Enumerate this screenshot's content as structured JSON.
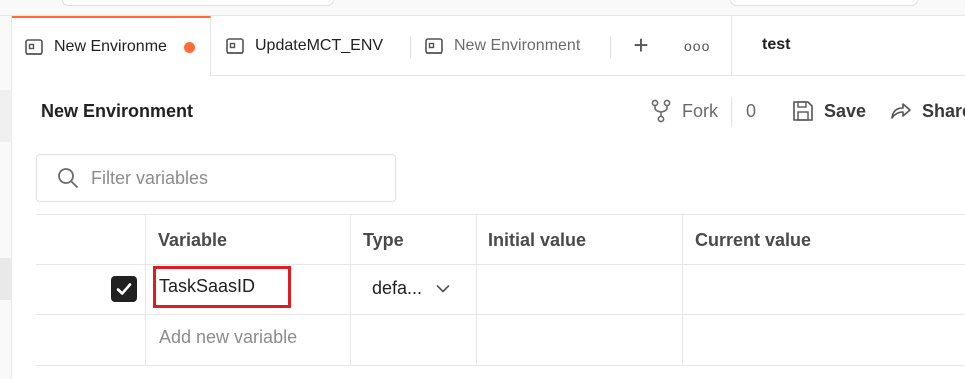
{
  "tabs": [
    {
      "label": "New Environme",
      "active": true,
      "unsaved": true,
      "icon": "environment-icon"
    },
    {
      "label": "UpdateMCT_ENV",
      "active": false,
      "icon": "environment-icon"
    },
    {
      "label": "New Environment",
      "active": false,
      "icon": "environment-icon"
    }
  ],
  "tab_actions": {
    "new_tab": "+",
    "more": "ooo"
  },
  "current_environment": "test",
  "header": {
    "title": "New Environment",
    "fork_label": "Fork",
    "fork_count": "0",
    "save_label": "Save",
    "share_label": "Share"
  },
  "filter": {
    "placeholder": "Filter variables",
    "value": ""
  },
  "table": {
    "columns": [
      "Variable",
      "Type",
      "Initial value",
      "Current value"
    ],
    "rows": [
      {
        "enabled": true,
        "variable": "TaskSaasID",
        "type": "defa...",
        "initial_value": "",
        "current_value": ""
      }
    ],
    "add_placeholder": "Add new variable"
  },
  "colors": {
    "accent": "#ff6c37",
    "highlight_box": "#e01b24"
  }
}
